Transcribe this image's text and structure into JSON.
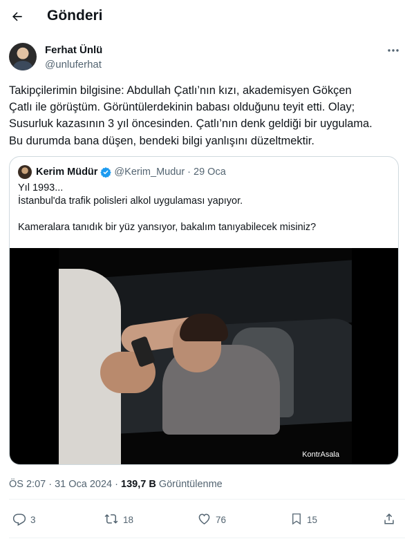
{
  "header": {
    "title": "Gönderi"
  },
  "author": {
    "name": "Ferhat Ünlü",
    "handle": "@unluferhat"
  },
  "tweet": {
    "lines": [
      "Takipçilerimin bilgisine: Abdullah Çatlı’nın kızı, akademisyen Gökçen",
      "Çatlı ile görüştüm. Görüntülerdekinin babası olduğunu teyit etti. Olay;",
      "Susurluk kazasının 3 yıl öncesinden. Çatlı’nın denk geldiği bir uygulama.",
      "Bu durumda bana düşen, bendeki bilgi yanlışını düzeltmektir."
    ]
  },
  "quote": {
    "name": "Kerim Müdür",
    "handle": "@Kerim_Mudur",
    "separator": "·",
    "date": "29 Oca",
    "line1": "Yıl 1993...",
    "line2": "İstanbul'da trafik polisleri alkol uygulaması yapıyor.",
    "line3": "Kameralara tanıdık bir yüz yansıyor, bakalım tanıyabilecek misiniz?",
    "watermark": "KontrAsala"
  },
  "meta": {
    "time": "ÖS 2:07 · 31 Oca 2024 · ",
    "views_count": "139,7 B",
    "views_label": " Görüntülenme"
  },
  "actions": {
    "replies": "3",
    "retweets": "18",
    "likes": "76",
    "bookmarks": "15"
  },
  "colors": {
    "text": "#0f1419",
    "muted": "#536471",
    "verified": "#1d9bf0",
    "border": "#cfd9de"
  }
}
